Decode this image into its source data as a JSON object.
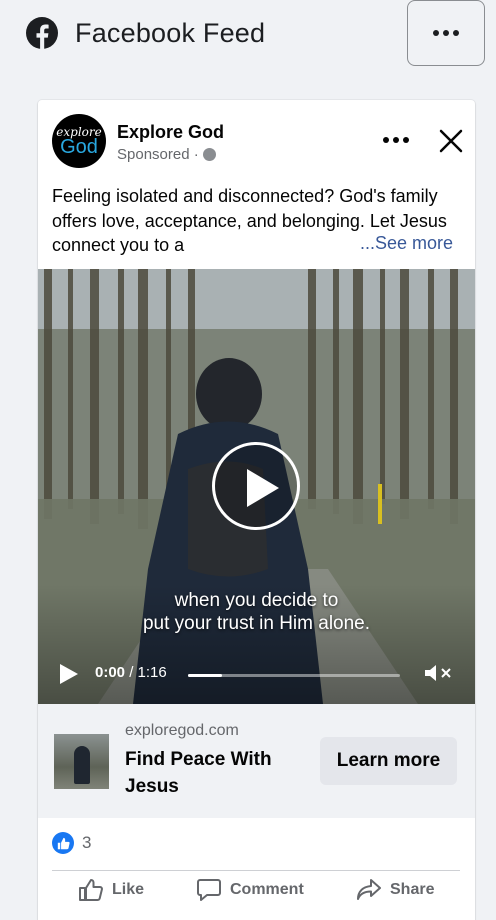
{
  "header": {
    "logo_icon": "facebook-logo-icon",
    "title": "Facebook Feed",
    "menu_icon": "more-horizontal-icon"
  },
  "post": {
    "avatar": {
      "line1": "explore",
      "line2": "God"
    },
    "page_name": "Explore God",
    "sponsored_label": "Sponsored ·",
    "audience_icon": "globe-icon",
    "more_icon": "more-horizontal-icon",
    "close_icon": "close-icon",
    "text": "Feeling isolated and disconnected? God's family offers love, acceptance, and belonging. Let Jesus connect you to a",
    "see_more": "...See more",
    "video": {
      "caption_line1": "when you decide to",
      "caption_line2": "put your trust in Him alone.",
      "current_time": "0:00",
      "duration": "/ 1:16",
      "progress_fraction": 0.16,
      "play_icon": "play-icon",
      "mute_icon": "speaker-muted-icon"
    },
    "link": {
      "domain": "exploregod.com",
      "title": "Find Peace With Jesus",
      "cta": "Learn more"
    },
    "reactions": {
      "icon": "like-reaction-icon",
      "count": "3"
    },
    "actions": [
      {
        "label": "Like",
        "icon": "thumbs-up-icon"
      },
      {
        "label": "Comment",
        "icon": "comment-icon"
      },
      {
        "label": "Share",
        "icon": "share-icon"
      }
    ]
  },
  "colors": {
    "background": "#f0f2f5",
    "link_blue": "#385898",
    "like_blue": "#1877f2",
    "secondary_text": "#65676b"
  }
}
